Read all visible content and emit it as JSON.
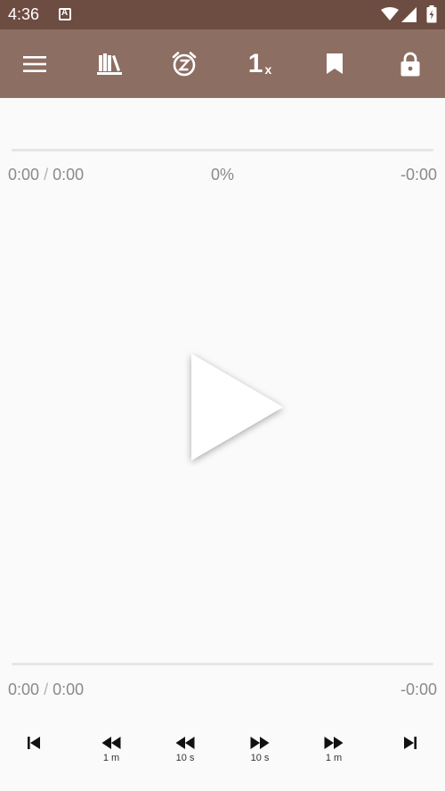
{
  "status_bar": {
    "time": "4:36",
    "icons": [
      "notification-a-icon",
      "wifi-icon",
      "cell-signal-icon",
      "battery-charging-icon"
    ]
  },
  "toolbar": {
    "buttons": [
      "menu-icon",
      "library-icon",
      "sleep-timer-icon",
      "speed",
      "bookmark-icon",
      "lock-icon"
    ],
    "speed_value": "1",
    "speed_unit": "x",
    "background": "#8d6e63"
  },
  "chapter_progress": {
    "elapsed": "0:00",
    "separator": "/",
    "duration": "0:00",
    "percent": "0%",
    "remaining": "-0:00",
    "value": 0
  },
  "book_progress": {
    "elapsed": "0:00",
    "separator": "/",
    "duration": "0:00",
    "remaining": "-0:00",
    "value": 0
  },
  "player": {
    "main_button_icon": "play-icon"
  },
  "controls": {
    "items": [
      {
        "icon": "skip-previous-icon",
        "label": ""
      },
      {
        "icon": "rewind-icon",
        "label": "1 m"
      },
      {
        "icon": "rewind-icon",
        "label": "10 s"
      },
      {
        "icon": "fast-forward-icon",
        "label": "10 s"
      },
      {
        "icon": "fast-forward-icon",
        "label": "1 m"
      },
      {
        "icon": "skip-next-icon",
        "label": ""
      }
    ]
  },
  "colors": {
    "status_bar": "#6d4c41",
    "toolbar": "#8d6e63",
    "background": "#fafafa"
  }
}
